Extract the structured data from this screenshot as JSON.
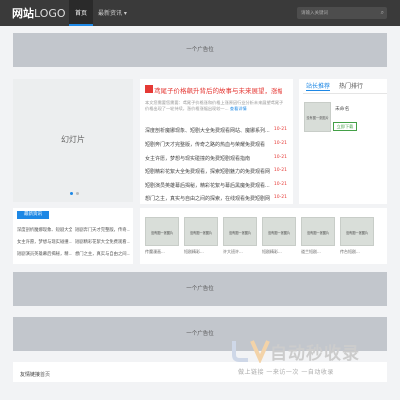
{
  "header": {
    "logo_bold": "网站",
    "logo_thin": "LOGO",
    "nav": [
      {
        "label": "首页"
      },
      {
        "label": "最新资讯 ▾"
      }
    ],
    "search_placeholder": "请输入关键词"
  },
  "ads": {
    "label": "一个广告位"
  },
  "slideshow": {
    "label": "幻灯片"
  },
  "featured": {
    "headline": "鸢尾子价格飙升背后的故事与未来展望，涨幅超11...",
    "summary": "本文您需要您需要：鸢尾子价格涨和价格上涨原因行业分析未来展望鸢尾子价格出现了一轮持续，涨价格涨幅出现较一...",
    "more": "查看详情"
  },
  "news_list": [
    {
      "title": "深度剖析魔娜现象、短剧大全免费观看网站、魔娜系列...",
      "date": "10-21"
    },
    {
      "title": "短剧奔门天才完整版，传奇之路的热血与荣耀免费观看",
      "date": "10-21"
    },
    {
      "title": "女主许愿，梦想与现实碰撞的免费短剧观看指南",
      "date": "10-21"
    },
    {
      "title": "短剧精彩花絮大全免费观看，探索短剧魅力的免费观看网站",
      "date": "10-21"
    },
    {
      "title": "短剧演员英雄幕后揭秘，精彩花絮与幕后黑魔免费观看...",
      "date": "10-21"
    },
    {
      "title": "想门之主，真实与自由之间的探索，在线观看免费短剧网站",
      "date": "10-21"
    }
  ],
  "side_tabs": [
    {
      "label": "站长推荐"
    },
    {
      "label": "热门排行"
    }
  ],
  "site_item": {
    "thumb": "没有图一张图片",
    "name": "未命名",
    "button": "立即下载"
  },
  "latest": {
    "badge": "最新资讯",
    "items": [
      {
        "title": "深度剖析魔娜现象、短剧大全..."
      },
      {
        "title": "短剧奔门天才完整版，传奇..."
      },
      {
        "title": "女主许愿，梦想与现实碰撞..."
      },
      {
        "title": "短剧精彩花絮大全免费观看..."
      },
      {
        "title": "短剧演员英雄幕后揭秘，精..."
      },
      {
        "title": "想门之主，真实与自由之间..."
      }
    ]
  },
  "gallery": {
    "thumb_text": "没有图一张图片",
    "items": [
      {
        "caption": "传魔漫画..."
      },
      {
        "caption": "短剧精彩..."
      },
      {
        "caption": "许大班许..."
      },
      {
        "caption": "短剧精彩..."
      },
      {
        "caption": "道兰短剧..."
      },
      {
        "caption": "传台短剧..."
      }
    ]
  },
  "footer": {
    "label": "友情链接",
    "link": "首页"
  },
  "watermark": {
    "text": "自动秒收录",
    "sub": "做上链接 一来访一次 一自动收录"
  },
  "colors": {
    "accent": "#1e88e5",
    "red": "#e53935",
    "green": "#43a047"
  }
}
